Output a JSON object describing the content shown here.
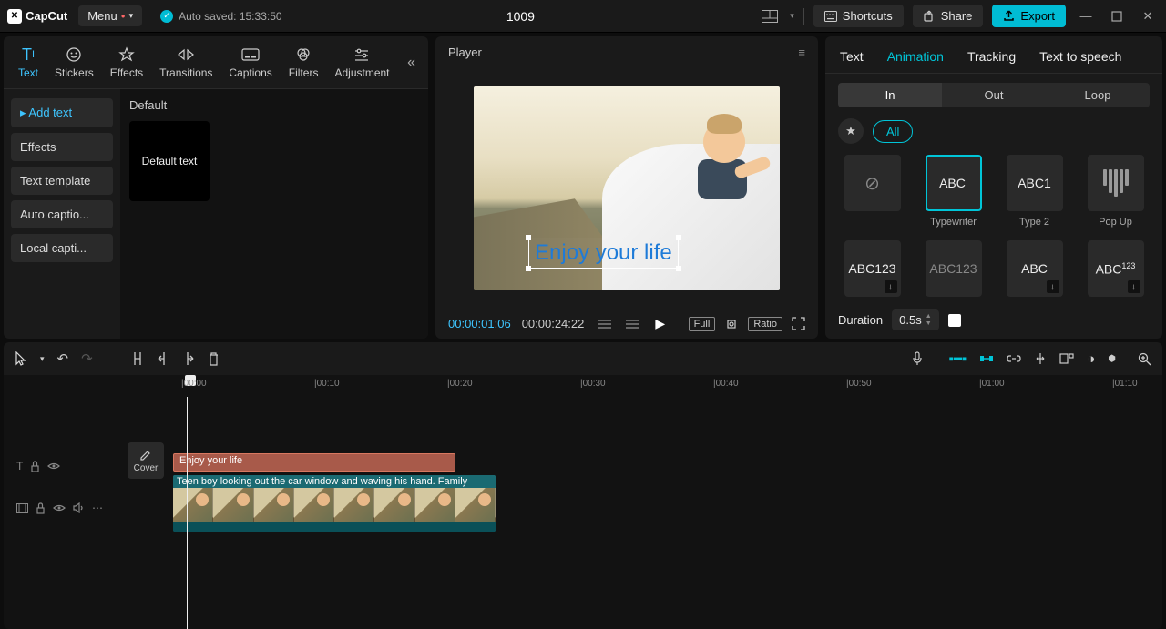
{
  "title": "1009",
  "logo": "CapCut",
  "menu": "Menu",
  "autosave": "Auto saved: 15:33:50",
  "shortcuts": "Shortcuts",
  "share": "Share",
  "export": "Export",
  "tooltabs": {
    "text": "Text",
    "stickers": "Stickers",
    "effects": "Effects",
    "transitions": "Transitions",
    "captions": "Captions",
    "filters": "Filters",
    "adjustment": "Adjustment"
  },
  "sidebar": {
    "add_text": "Add text",
    "effects": "Effects",
    "text_template": "Text template",
    "auto_captions": "Auto captio...",
    "local_captions": "Local capti..."
  },
  "content": {
    "header": "Default",
    "default_text": "Default text"
  },
  "player": {
    "label": "Player",
    "overlay_text": "Enjoy your life",
    "current": "00:00:01:06",
    "duration": "00:00:24:22",
    "full": "Full",
    "ratio": "Ratio"
  },
  "right": {
    "tabs": {
      "text": "Text",
      "animation": "Animation",
      "tracking": "Tracking",
      "tts": "Text to speech"
    },
    "subtabs": {
      "in": "In",
      "out": "Out",
      "loop": "Loop"
    },
    "all": "All",
    "anim": {
      "typewriter": "Typewriter",
      "type2": "Type 2",
      "popup": "Pop Up",
      "abc": "ABC",
      "abc1": "ABC1",
      "abc123": "ABC123",
      "abc123_2": "ABC123",
      "abc_3": "ABC",
      "abc123_4": "ABC123"
    },
    "duration_label": "Duration",
    "duration_value": "0.5s"
  },
  "ruler": [
    "00:00",
    "00:10",
    "00:20",
    "00:30",
    "00:40",
    "00:50",
    "01:00",
    "01:10"
  ],
  "timeline": {
    "text_clip": "Enjoy your life",
    "video_clip": "Teen boy looking out the car window and waving his hand. Family",
    "cover": "Cover"
  }
}
